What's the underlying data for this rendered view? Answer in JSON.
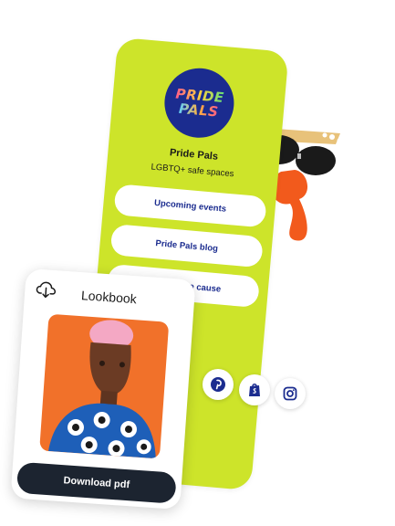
{
  "profile": {
    "logo_line1": "PRIDE",
    "logo_line2": "PALS",
    "name": "Pride Pals",
    "tagline": "LGBTQ+ safe spaces"
  },
  "links": [
    {
      "label": "Upcoming events"
    },
    {
      "label": "Pride Pals blog"
    },
    {
      "label": "Support the cause"
    }
  ],
  "social": [
    {
      "icon": "pinterest-icon"
    },
    {
      "icon": "shopify-icon"
    },
    {
      "icon": "instagram-icon"
    }
  ],
  "lookbook": {
    "title": "Lookbook",
    "button_label": "Download pdf",
    "icon": "cloud-download-icon"
  },
  "colors": {
    "card_bg": "#cde42a",
    "link_text": "#1b2c8f",
    "logo_bg": "#1b2c8f",
    "button_bg": "#1c2430",
    "photo_bg": "#f1712a"
  }
}
